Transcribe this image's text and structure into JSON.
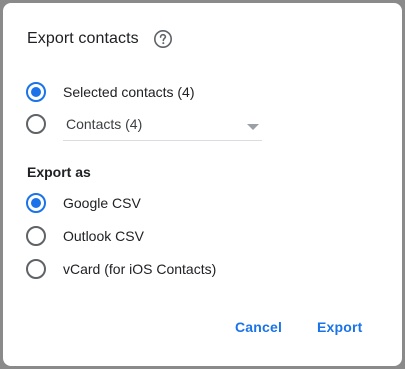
{
  "dialog": {
    "title": "Export contacts",
    "help_icon": "help-circle-icon"
  },
  "scope": {
    "options": [
      {
        "label": "Selected contacts (4)",
        "checked": true
      },
      {
        "label": "",
        "checked": false
      }
    ],
    "dropdown": {
      "selected": "Contacts (4)",
      "icon": "dropdown-arrow-icon"
    }
  },
  "export_as": {
    "heading": "Export as",
    "options": [
      {
        "label": "Google CSV",
        "checked": true
      },
      {
        "label": "Outlook CSV",
        "checked": false
      },
      {
        "label": "vCard (for iOS Contacts)",
        "checked": false
      }
    ]
  },
  "actions": {
    "cancel_label": "Cancel",
    "export_label": "Export"
  },
  "colors": {
    "accent": "#1a73e8",
    "text": "#202124",
    "radio_unchecked": "#5f6368"
  }
}
